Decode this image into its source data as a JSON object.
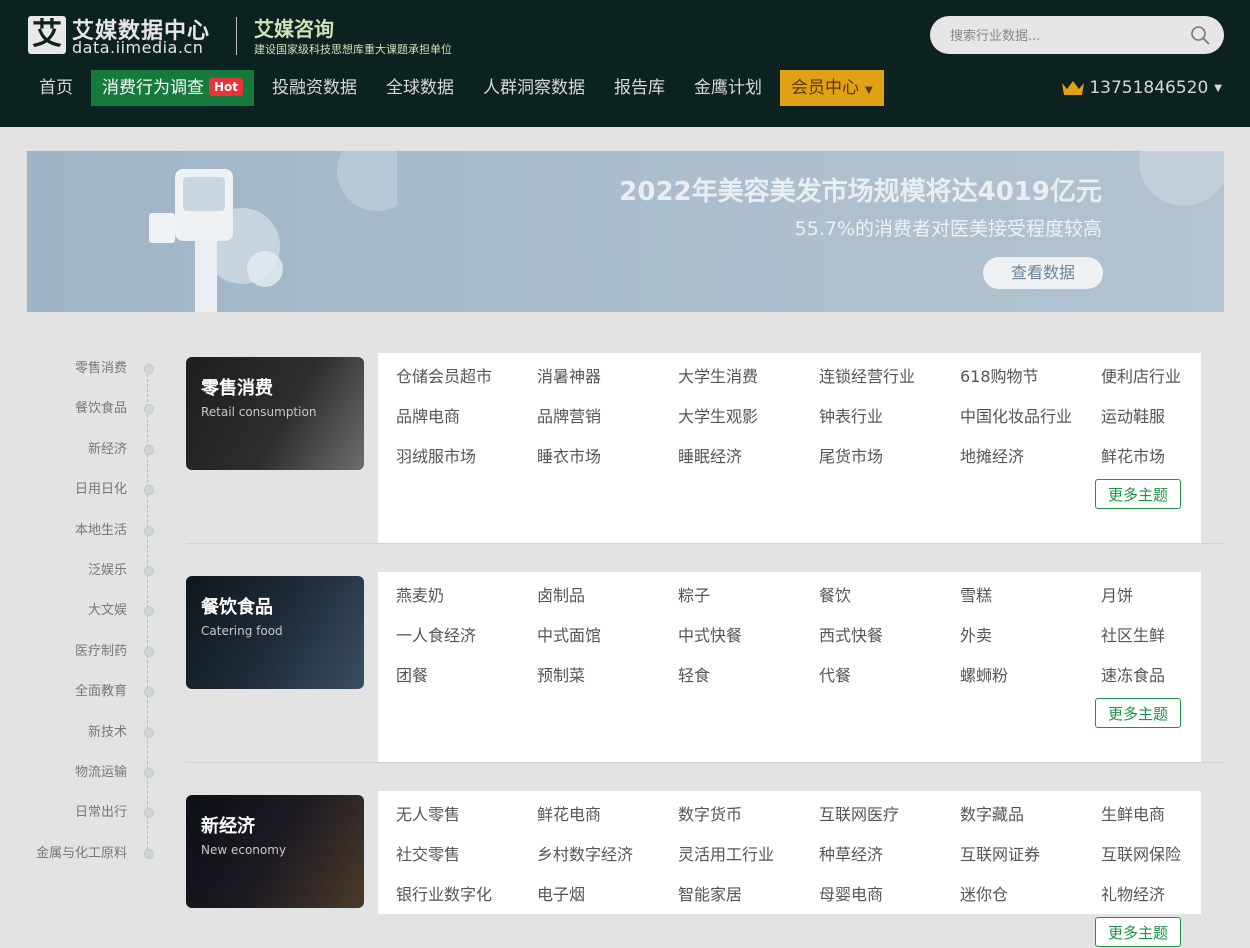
{
  "header": {
    "logo_mark": "艾",
    "logo_cn": "艾媒数据中心",
    "logo_en": "data.iimedia.cn",
    "brand2": "艾媒咨询",
    "brand2_sub": "建设国家级科技思想库重大课题承担单位",
    "search_placeholder": "搜索行业数据...",
    "user_phone": "13751846520"
  },
  "nav": {
    "items": [
      {
        "label": "首页"
      },
      {
        "label": "消费行为调查",
        "badge": "Hot"
      },
      {
        "label": "投融资数据"
      },
      {
        "label": "全球数据"
      },
      {
        "label": "人群洞察数据"
      },
      {
        "label": "报告库"
      },
      {
        "label": "金鹰计划"
      },
      {
        "label": "会员中心"
      }
    ]
  },
  "banner": {
    "title": "2022年美容美发市场规模将达4019亿元",
    "subtitle": "55.7%的消费者对医美接受程度较高",
    "button": "查看数据"
  },
  "side_nav": [
    "零售消费",
    "餐饮食品",
    "新经济",
    "日用日化",
    "本地生活",
    "泛娱乐",
    "大文娱",
    "医疗制药",
    "全面教育",
    "新技术",
    "物流运输",
    "日常出行",
    "金属与化工原料"
  ],
  "sections": [
    {
      "name": "零售消费",
      "name_en": "Retail consumption",
      "topics": [
        "仓储会员超市",
        "消暑神器",
        "大学生消费",
        "连锁经营行业",
        "618购物节",
        "便利店行业",
        "品牌电商",
        "品牌营销",
        "大学生观影",
        "钟表行业",
        "中国化妆品行业",
        "运动鞋服",
        "羽绒服市场",
        "睡衣市场",
        "睡眠经济",
        "尾货市场",
        "地摊经济",
        "鲜花市场"
      ],
      "more": "更多主题"
    },
    {
      "name": "餐饮食品",
      "name_en": "Catering food",
      "topics": [
        "燕麦奶",
        "卤制品",
        "粽子",
        "餐饮",
        "雪糕",
        "月饼",
        "一人食经济",
        "中式面馆",
        "中式快餐",
        "西式快餐",
        "外卖",
        "社区生鲜",
        "团餐",
        "预制菜",
        "轻食",
        "代餐",
        "螺蛳粉",
        "速冻食品"
      ],
      "more": "更多主题"
    },
    {
      "name": "新经济",
      "name_en": "New economy",
      "topics": [
        "无人零售",
        "鲜花电商",
        "数字货币",
        "互联网医疗",
        "数字藏品",
        "生鲜电商",
        "社交零售",
        "乡村数字经济",
        "灵活用工行业",
        "种草经济",
        "互联网证券",
        "互联网保险",
        "银行业数字化",
        "电子烟",
        "智能家居",
        "母婴电商",
        "迷你仓",
        "礼物经济"
      ],
      "more": "更多主题"
    }
  ]
}
